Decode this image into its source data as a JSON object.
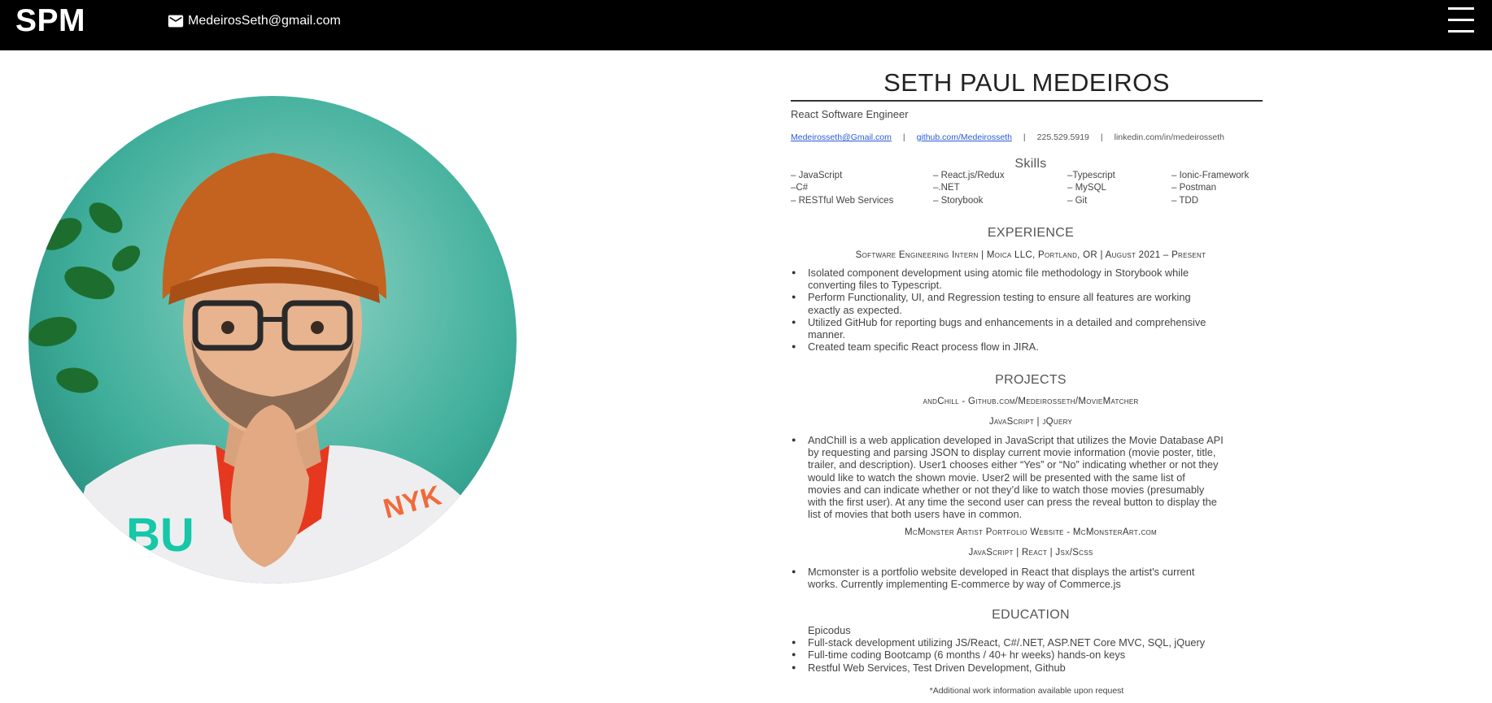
{
  "header": {
    "logo": "SPM",
    "email": "MedeirosSeth@gmail.com",
    "mail_icon": "mail-icon",
    "menu_icon": "hamburger-menu-icon",
    "background": "#000000"
  },
  "photo": {
    "alt": "Portrait photo"
  },
  "resume": {
    "name": "SETH PAUL MEDEIROS",
    "role": "React Software Engineer",
    "contact": {
      "email": "Medeirosseth@Gmail.com",
      "github": "github.com/Medeirosseth",
      "phone": "225.529.5919",
      "linkedin": "linkedin.com/in/medeirosseth",
      "separator": "|"
    },
    "skills_heading": "Skills",
    "skills_columns": [
      [
        "– JavaScript",
        "–C#",
        "– RESTful Web Services"
      ],
      [
        "– React.js/Redux",
        "–.NET",
        "– Storybook"
      ],
      [
        "–Typescript",
        "– MySQL",
        "– Git"
      ],
      [
        "– Ionic-Framework",
        "–  Postman",
        "– TDD"
      ]
    ],
    "experience_heading": "EXPERIENCE",
    "experience_job": "Software Engineering Intern | Moica LLC,  Portland, OR | August  2021 – Present",
    "experience_bullets": [
      [
        "Isolated component development using atomic file methodology in Storybook while",
        "converting files to Typescript."
      ],
      [
        "Perform Functionality, UI, and Regression testing to ensure all features are working",
        "exactly as expected."
      ],
      [
        "Utilized GitHub for reporting bugs and enhancements in a detailed and comprehensive",
        "manner."
      ],
      [
        "Created team specific React process flow in JIRA."
      ]
    ],
    "projects_heading": "PROJECTS",
    "project1_title": "andChill - Github.com/Medeirosseth/MovieMatcher",
    "project1_tech": "JavaScript | jQuery",
    "project1_bullet": [
      "AndChill is a web application developed in JavaScript that utilizes the Movie Database API",
      "by requesting and parsing JSON to display current movie information (movie poster, title,",
      "trailer, and description). User1 chooses either “Yes” or “No”  indicating whether or not they",
      "would like to watch the shown movie. User2 will be presented with the same list of",
      "movies and can indicate whether or not they’d like to watch those movies (presumably",
      "with the first user). At any time the second user can press the reveal button to display the",
      "list of movies that both users have in common."
    ],
    "project2_title": "McMonster Artist Portfolio Website - McMonsterArt.com",
    "project2_tech": "JavaScript | React  | Jsx/Scss",
    "project2_bullet": [
      "Mcmonster is a portfolio website developed in React that displays the artist's current",
      "works. Currently implementing E-commerce by way of Commerce.js"
    ],
    "education_heading": "EDUCATION",
    "education_school": "Epicodus",
    "education_bullets": [
      "Full-stack development utilizing JS/React, C#/.NET, ASP.NET Core MVC, SQL, jQuery",
      "Full-time coding Bootcamp (6 months / 40+ hr weeks) hands-on keys",
      "Restful Web Services, Test Driven Development, Github"
    ],
    "footnote": "*Additional work information available upon request"
  }
}
